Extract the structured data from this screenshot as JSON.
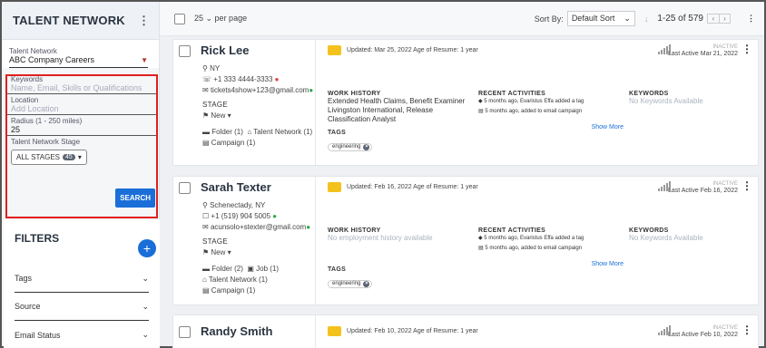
{
  "sidebar": {
    "title": "TALENT NETWORK",
    "talent_network_label": "Talent Network",
    "talent_network_value": "ABC Company Careers",
    "keywords_label": "Keywords",
    "keywords_placeholder": "Name, Email, Skills or Qualifications",
    "location_label": "Location",
    "location_placeholder": "Add Location",
    "radius_label": "Radius (1 - 250 miles)",
    "radius_value": "25",
    "stage_label": "Talent Network Stage",
    "stage_value": "ALL STAGES",
    "stage_count": "45",
    "search_label": "SEARCH",
    "filters_title": "FILTERS",
    "filter_items": [
      "Tags",
      "Source",
      "Email Status"
    ]
  },
  "topbar": {
    "per_page": "25  ⌄ per page",
    "sort_by": "Sort By:",
    "sort_value": "Default Sort",
    "range": "1-25 of 579"
  },
  "labels": {
    "stage": "STAGE",
    "work_history": "WORK HISTORY",
    "recent_activities": "RECENT ACTIVITIES",
    "keywords": "KEYWORDS",
    "tags": "TAGS",
    "show_more": "Show More",
    "inactive": "INACTIVE"
  },
  "candidates": [
    {
      "name": "Rick Lee",
      "location": "NY",
      "phone": "+1 333 4444-3333",
      "email": "tickets4show+123@gmail.com",
      "stage": "New",
      "folder": "Folder (1)",
      "talent_network": "Talent Network (1)",
      "job": "",
      "campaign": "Campaign (1)",
      "updated": "Updated: Mar 25, 2022  Age of Resume: 1 year",
      "last_active": "Last Active Mar 21, 2022",
      "work_history": "Extended Health Claims, Benefit Examiner Livingston International, Release Classification Analyst",
      "activity_1": "5 months ago, Evaristus Effa added a tag",
      "activity_2": "5 months ago, added to email campaign",
      "keywords": "No Keywords Available",
      "tag": "engineering"
    },
    {
      "name": "Sarah Texter",
      "location": "Schenectady, NY",
      "phone": "+1 (519) 904 5005",
      "email": "acunsolo+stexter@gmail.com",
      "stage": "New",
      "folder": "Folder (2)",
      "talent_network": "Talent Network (1)",
      "job": "Job (1)",
      "campaign": "Campaign (1)",
      "updated": "Updated: Feb 16, 2022  Age of Resume: 1 year",
      "last_active": "Last Active Feb 16, 2022",
      "work_history": "No employment history available",
      "activity_1": "5 months ago, Evaristus Effa added a tag",
      "activity_2": "5 months ago, added to email campaign",
      "keywords": "No Keywords Available",
      "tag": "engineering"
    },
    {
      "name": "Randy Smith",
      "updated": "Updated: Feb 10, 2022  Age of Resume: 1 year",
      "last_active": "Last Active Feb 10, 2022"
    }
  ]
}
